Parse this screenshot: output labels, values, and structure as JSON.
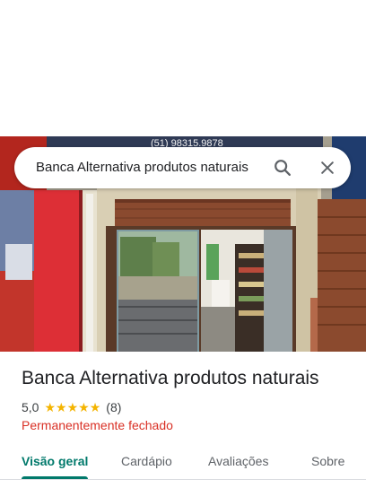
{
  "search": {
    "query": "Banca Alternativa produtos naturais"
  },
  "photo": {
    "sign_text": "(51) 98315.9878"
  },
  "place": {
    "name": "Banca Alternativa produtos naturais",
    "rating": "5,0",
    "stars": 5,
    "review_count": "(8)",
    "status": "Permanentemente fechado"
  },
  "tabs": [
    {
      "label": "Visão geral",
      "active": true
    },
    {
      "label": "Cardápio",
      "active": false
    },
    {
      "label": "Avaliações",
      "active": false
    },
    {
      "label": "Sobre",
      "active": false
    }
  ],
  "colors": {
    "accent": "#00796b",
    "status_closed": "#d93025",
    "star": "#f4b400"
  },
  "icons": [
    "search-icon",
    "close-icon",
    "star-icon"
  ]
}
